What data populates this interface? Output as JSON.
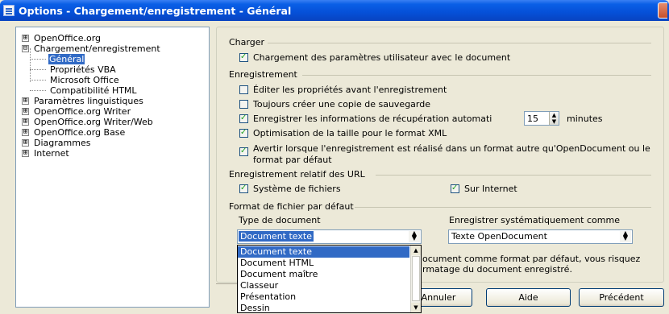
{
  "window": {
    "title": "Options - Chargement/enregistrement - Général"
  },
  "tree": {
    "items": [
      {
        "label": "OpenOffice.org",
        "expander": "⊞"
      },
      {
        "label": "Chargement/enregistrement",
        "expander": "⊟"
      },
      {
        "label": "Général"
      },
      {
        "label": "Propriétés VBA"
      },
      {
        "label": "Microsoft Office"
      },
      {
        "label": "Compatibilité HTML"
      },
      {
        "label": "Paramètres linguistiques",
        "expander": "⊞"
      },
      {
        "label": "OpenOffice.org Writer",
        "expander": "⊞"
      },
      {
        "label": "OpenOffice.org Writer/Web",
        "expander": "⊞"
      },
      {
        "label": "OpenOffice.org Base",
        "expander": "⊞"
      },
      {
        "label": "Diagrammes",
        "expander": "⊞"
      },
      {
        "label": "Internet",
        "expander": "⊞"
      }
    ]
  },
  "charger": {
    "title": "Charger",
    "load_user_settings": "Chargement des paramètres utilisateur avec le document"
  },
  "enregistrement": {
    "title": "Enregistrement",
    "edit_properties": "Éditer les propriétés avant l'enregistrement",
    "always_backup": "Toujours créer une copie de sauvegarde",
    "autosave": "Enregistrer les informations de récupération automati",
    "autosave_minutes": "15",
    "minutes_label": "minutes",
    "optimize_xml": "Optimisation de la taille pour le format XML",
    "warn_line1": "Avertir lorsque l'enregistrement est réalisé dans un format autre qu'OpenDocument ou le",
    "warn_line2": "format par défaut"
  },
  "relative_urls": {
    "title": "Enregistrement relatif des URL",
    "file_system": "Système de fichiers",
    "internet": "Sur Internet"
  },
  "default_format": {
    "title": "Format de fichier par défaut",
    "doc_type_label": "Type de document",
    "always_save_as_label": "Enregistrer systématiquement comme",
    "doc_type_value": "Document texte",
    "always_save_as_value": "Texte OpenDocument",
    "info_line1": "ocument comme format par défaut, vous risquez",
    "info_line2": "rmatage du document enregistré.",
    "dropdown_options": [
      "Document texte",
      "Document HTML",
      "Document maître",
      "Classeur",
      "Présentation",
      "Dessin"
    ]
  },
  "buttons": {
    "cancel": "Annuler",
    "help": "Aide",
    "previous": "Précédent"
  }
}
